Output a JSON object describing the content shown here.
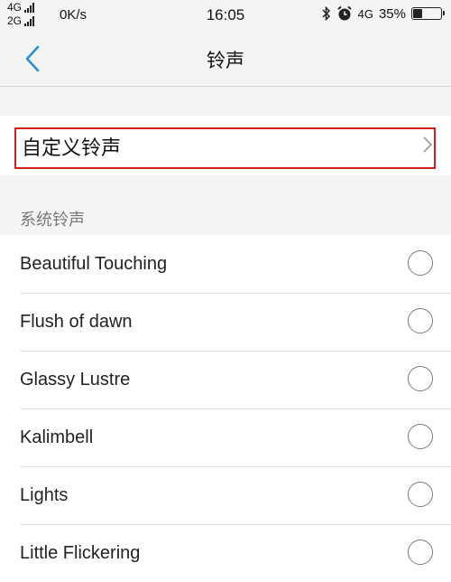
{
  "status_bar": {
    "net_top": "4G",
    "net_bottom": "2G",
    "speed": "0K/s",
    "time": "16:05",
    "net_right": "4G",
    "battery": "35%",
    "battery_level": 0.35,
    "icons": [
      "bluetooth-icon",
      "alarm-icon",
      "battery-icon"
    ]
  },
  "nav": {
    "title": "铃声",
    "back_icon": "chevron-left-icon"
  },
  "custom": {
    "label": "自定义铃声",
    "chevron_icon": "chevron-right-icon"
  },
  "section": {
    "header": "系统铃声"
  },
  "ringtones": [
    {
      "name": "Beautiful Touching",
      "selected": false
    },
    {
      "name": "Flush of dawn",
      "selected": false
    },
    {
      "name": "Glassy Lustre",
      "selected": false
    },
    {
      "name": "Kalimbell",
      "selected": false
    },
    {
      "name": "Lights",
      "selected": false
    },
    {
      "name": "Little Flickering",
      "selected": false
    }
  ],
  "colors": {
    "accent": "#2a8fd6",
    "highlight_border": "#d21f1f",
    "background": "#f4f4f4"
  }
}
